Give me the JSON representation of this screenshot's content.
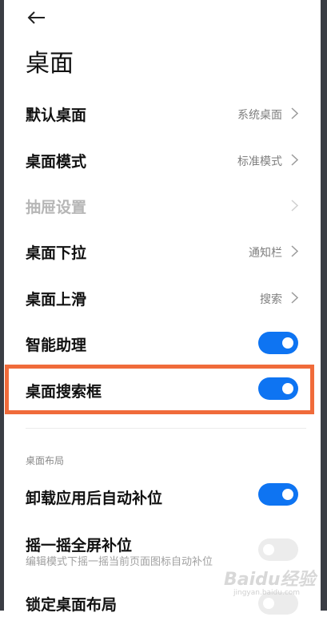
{
  "header": {
    "back_icon": "back-arrow-icon",
    "title": "桌面"
  },
  "settings": [
    {
      "label": "默认桌面",
      "value": "系统桌面",
      "type": "link"
    },
    {
      "label": "桌面模式",
      "value": "标准模式",
      "type": "link"
    },
    {
      "label": "抽屉设置",
      "value": "",
      "type": "link",
      "disabled": true
    },
    {
      "label": "桌面下拉",
      "value": "通知栏",
      "type": "link"
    },
    {
      "label": "桌面上滑",
      "value": "搜索",
      "type": "link"
    },
    {
      "label": "智能助理",
      "type": "toggle",
      "on": true
    },
    {
      "label": "桌面搜索框",
      "type": "toggle",
      "on": true,
      "highlighted": true
    }
  ],
  "layout_section": {
    "title": "桌面布局",
    "items": [
      {
        "label": "卸载应用后自动补位",
        "type": "toggle",
        "on": true
      },
      {
        "label": "摇一摇全屏补位",
        "subtitle": "编辑模式下摇一摇当前页面图标自动补位",
        "type": "toggle",
        "on": false
      },
      {
        "label": "锁定桌面布局",
        "type": "toggle",
        "on": false
      }
    ]
  },
  "watermark": {
    "text": "Baidu经验",
    "sub": "jingyan.baidu.com"
  },
  "colors": {
    "accent": "#0e74f2",
    "highlight_border": "#f06b3a",
    "disabled_text": "#b6b6b6"
  }
}
